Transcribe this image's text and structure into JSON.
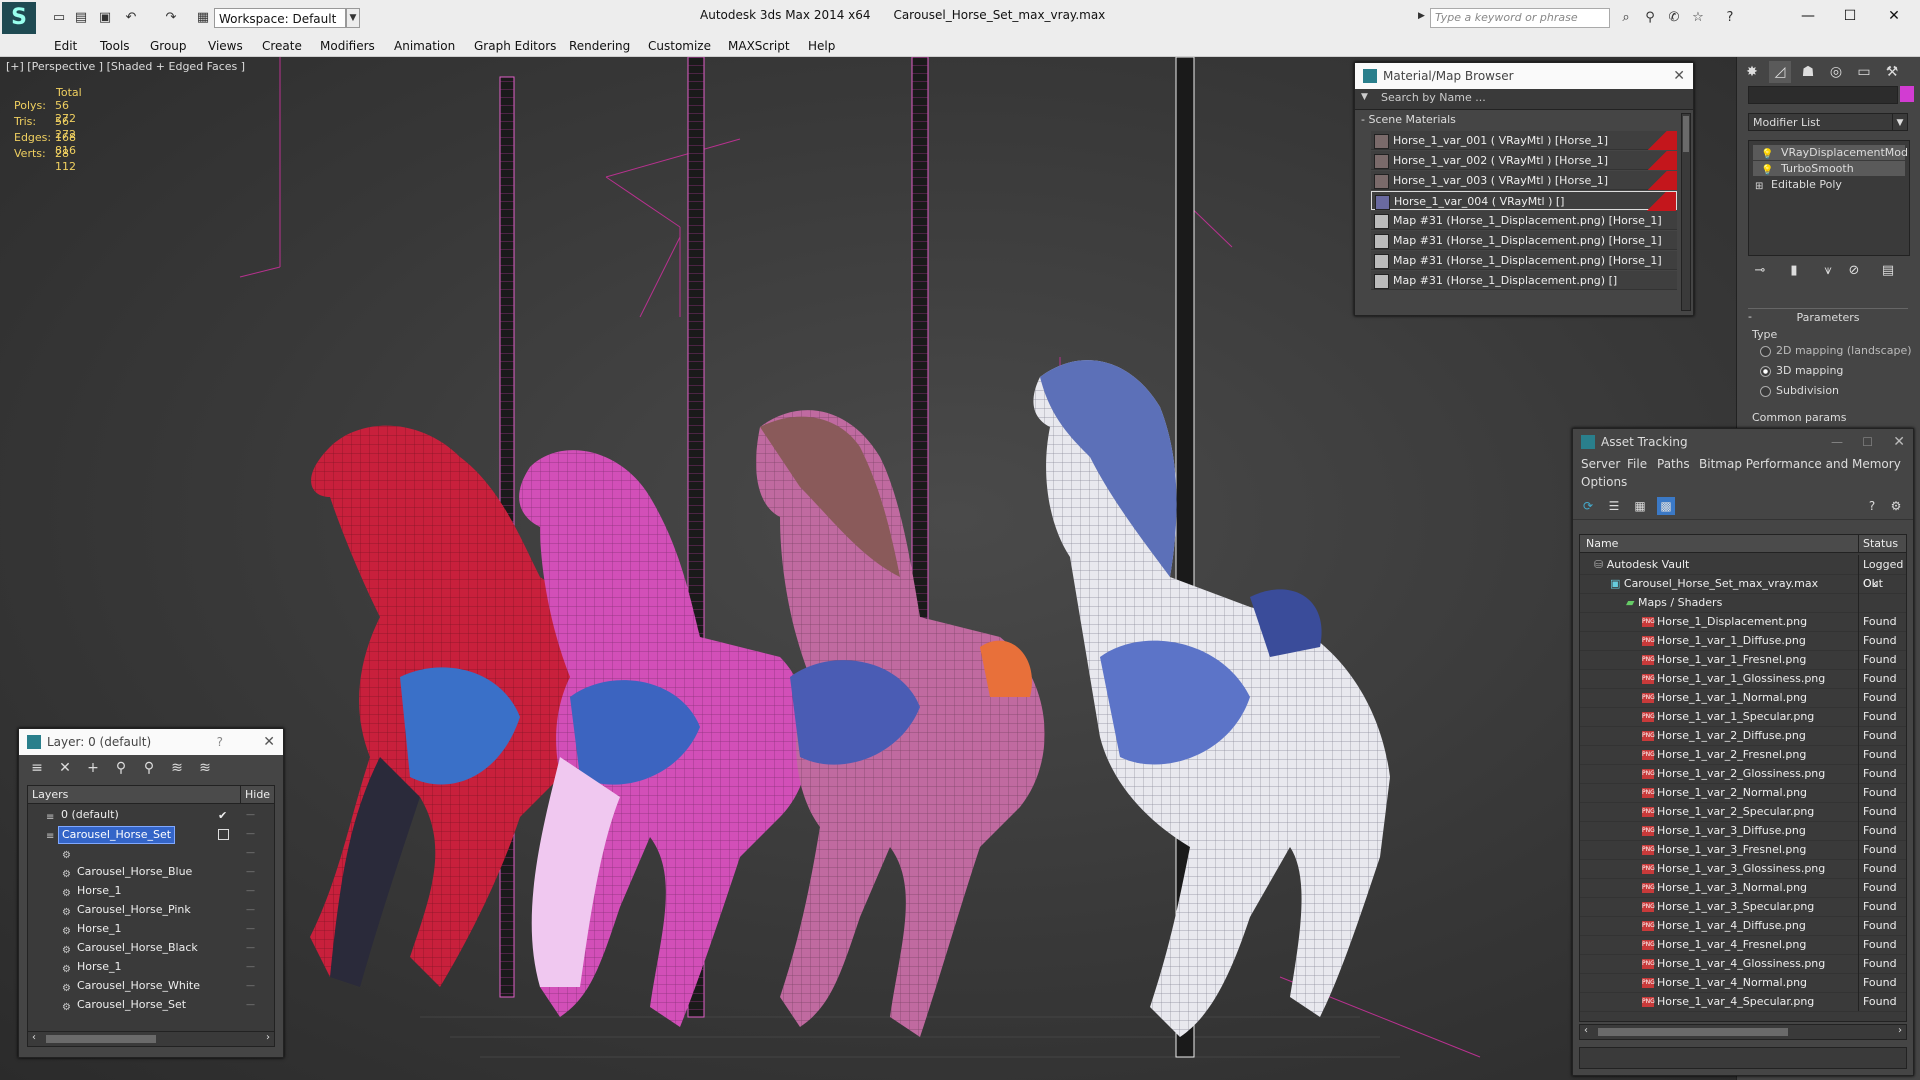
{
  "app": {
    "title": "Autodesk 3ds Max  2014 x64",
    "file": "Carousel_Horse_Set_max_vray.max",
    "workspace": "Workspace: Default",
    "search_placeholder": "Type a keyword or phrase"
  },
  "menu": [
    "Edit",
    "Tools",
    "Group",
    "Views",
    "Create",
    "Modifiers",
    "Animation",
    "Graph Editors",
    "Rendering",
    "Customize",
    "MAXScript",
    "Help"
  ],
  "viewport": {
    "label": "[+] [Perspective ] [Shaded + Edged Faces ]",
    "stats": {
      "header": "Total",
      "rows": [
        {
          "label": "Polys:",
          "value": "56 272"
        },
        {
          "label": "Tris:",
          "value": "56 272"
        },
        {
          "label": "Edges:",
          "value": "168 816"
        },
        {
          "label": "Verts:",
          "value": "28 112"
        }
      ]
    },
    "horse_colors": [
      "#c8203c",
      "#c63aa8",
      "#b74a74",
      "#3c58a8"
    ]
  },
  "material_browser": {
    "title": "Material/Map Browser",
    "search": "Search by Name ...",
    "section": "- Scene Materials",
    "items": [
      {
        "label": "Horse_1_var_001  ( VRayMtl )  [Horse_1]",
        "flag": true
      },
      {
        "label": "Horse_1_var_002  ( VRayMtl )  [Horse_1]",
        "flag": true
      },
      {
        "label": "Horse_1_var_003  ( VRayMtl )  [Horse_1]",
        "flag": true
      },
      {
        "label": "Horse_1_var_004  ( VRayMtl )  []",
        "flag": true
      },
      {
        "label": "Map #31 (Horse_1_Displacement.png) [Horse_1]",
        "flag": false
      },
      {
        "label": "Map #31 (Horse_1_Displacement.png) [Horse_1]",
        "flag": false
      },
      {
        "label": "Map #31 (Horse_1_Displacement.png) [Horse_1]",
        "flag": false
      },
      {
        "label": "Map #31 (Horse_1_Displacement.png) []",
        "flag": false
      }
    ]
  },
  "command_panel": {
    "modifier_list": "Modifier List",
    "stack": [
      "VRayDisplacementMod",
      "TurboSmooth",
      "Editable Poly"
    ],
    "parameters_title": "Parameters",
    "type_label": "Type",
    "type_options": [
      "2D mapping (landscape)",
      "3D mapping",
      "Subdivision"
    ],
    "type_selected": 1,
    "common_label": "Common params"
  },
  "asset_tracking": {
    "title": "Asset Tracking",
    "menu": [
      "Server",
      "File",
      "Paths",
      "Bitmap Performance and Memory",
      "Options"
    ],
    "columns": [
      "Name",
      "Status"
    ],
    "rows": [
      {
        "name": "Autodesk Vault",
        "status": "Logged Out",
        "indent": 1,
        "kind": "vault"
      },
      {
        "name": "Carousel_Horse_Set_max_vray.max",
        "status": "Ok",
        "indent": 2,
        "kind": "max"
      },
      {
        "name": "Maps / Shaders",
        "status": "",
        "indent": 3,
        "kind": "folder"
      },
      {
        "name": "Horse_1_Displacement.png",
        "status": "Found",
        "indent": 4,
        "kind": "png"
      },
      {
        "name": "Horse_1_var_1_Diffuse.png",
        "status": "Found",
        "indent": 4,
        "kind": "png"
      },
      {
        "name": "Horse_1_var_1_Fresnel.png",
        "status": "Found",
        "indent": 4,
        "kind": "png"
      },
      {
        "name": "Horse_1_var_1_Glossiness.png",
        "status": "Found",
        "indent": 4,
        "kind": "png"
      },
      {
        "name": "Horse_1_var_1_Normal.png",
        "status": "Found",
        "indent": 4,
        "kind": "png"
      },
      {
        "name": "Horse_1_var_1_Specular.png",
        "status": "Found",
        "indent": 4,
        "kind": "png"
      },
      {
        "name": "Horse_1_var_2_Diffuse.png",
        "status": "Found",
        "indent": 4,
        "kind": "png"
      },
      {
        "name": "Horse_1_var_2_Fresnel.png",
        "status": "Found",
        "indent": 4,
        "kind": "png"
      },
      {
        "name": "Horse_1_var_2_Glossiness.png",
        "status": "Found",
        "indent": 4,
        "kind": "png"
      },
      {
        "name": "Horse_1_var_2_Normal.png",
        "status": "Found",
        "indent": 4,
        "kind": "png"
      },
      {
        "name": "Horse_1_var_2_Specular.png",
        "status": "Found",
        "indent": 4,
        "kind": "png"
      },
      {
        "name": "Horse_1_var_3_Diffuse.png",
        "status": "Found",
        "indent": 4,
        "kind": "png"
      },
      {
        "name": "Horse_1_var_3_Fresnel.png",
        "status": "Found",
        "indent": 4,
        "kind": "png"
      },
      {
        "name": "Horse_1_var_3_Glossiness.png",
        "status": "Found",
        "indent": 4,
        "kind": "png"
      },
      {
        "name": "Horse_1_var_3_Normal.png",
        "status": "Found",
        "indent": 4,
        "kind": "png"
      },
      {
        "name": "Horse_1_var_3_Specular.png",
        "status": "Found",
        "indent": 4,
        "kind": "png"
      },
      {
        "name": "Horse_1_var_4_Diffuse.png",
        "status": "Found",
        "indent": 4,
        "kind": "png"
      },
      {
        "name": "Horse_1_var_4_Fresnel.png",
        "status": "Found",
        "indent": 4,
        "kind": "png"
      },
      {
        "name": "Horse_1_var_4_Glossiness.png",
        "status": "Found",
        "indent": 4,
        "kind": "png"
      },
      {
        "name": "Horse_1_var_4_Normal.png",
        "status": "Found",
        "indent": 4,
        "kind": "png"
      },
      {
        "name": "Horse_1_var_4_Specular.png",
        "status": "Found",
        "indent": 4,
        "kind": "png"
      }
    ]
  },
  "layer_panel": {
    "title": "Layer: 0 (default)",
    "help": "?",
    "columns": [
      "Layers",
      "Hide"
    ],
    "rows": [
      {
        "name": "0 (default)",
        "indent": 0,
        "kind": "layer",
        "selected": false,
        "check": true
      },
      {
        "name": "Carousel_Horse_Set",
        "indent": 0,
        "kind": "layer",
        "selected": true,
        "check": false
      },
      {
        "name": "",
        "indent": 1,
        "kind": "object",
        "selected": false,
        "check": false
      },
      {
        "name": "Carousel_Horse_Blue",
        "indent": 1,
        "kind": "object",
        "selected": false,
        "check": false
      },
      {
        "name": "Horse_1",
        "indent": 1,
        "kind": "object",
        "selected": false,
        "check": false
      },
      {
        "name": "Carousel_Horse_Pink",
        "indent": 1,
        "kind": "object",
        "selected": false,
        "check": false
      },
      {
        "name": "Horse_1",
        "indent": 1,
        "kind": "object",
        "selected": false,
        "check": false
      },
      {
        "name": "Carousel_Horse_Black",
        "indent": 1,
        "kind": "object",
        "selected": false,
        "check": false
      },
      {
        "name": "Horse_1",
        "indent": 1,
        "kind": "object",
        "selected": false,
        "check": false
      },
      {
        "name": "Carousel_Horse_White",
        "indent": 1,
        "kind": "object",
        "selected": false,
        "check": false
      },
      {
        "name": "Carousel_Horse_Set",
        "indent": 1,
        "kind": "object",
        "selected": false,
        "check": false
      }
    ]
  }
}
